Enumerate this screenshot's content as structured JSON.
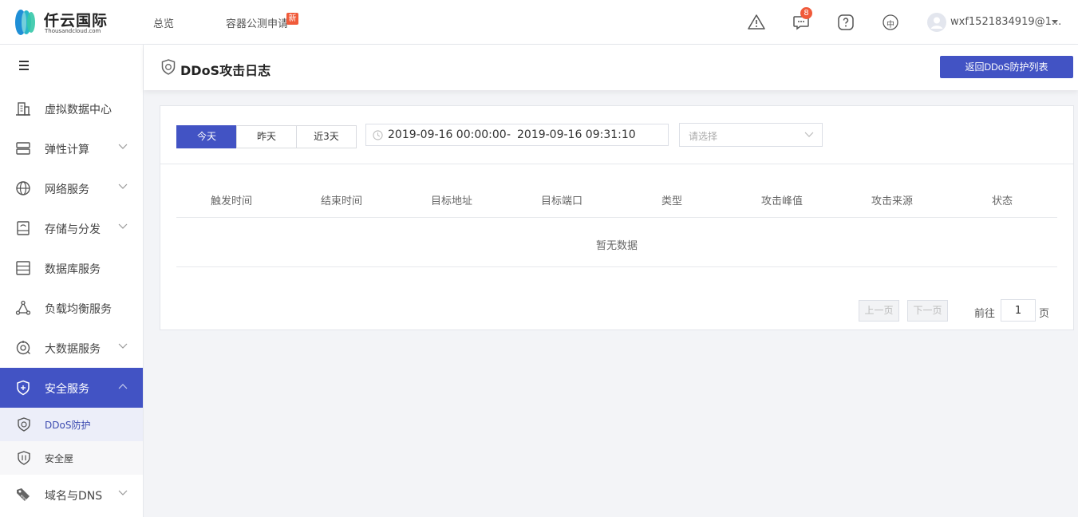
{
  "brand": {
    "name": "仟云国际",
    "subtitle": "Thousandcloud.com"
  },
  "topnav": {
    "overview": "总览",
    "container": "容器公测申请",
    "container_badge": "新"
  },
  "header_icons": {
    "alert": "alert-triangle-icon",
    "message": "chat-icon",
    "message_count": "8",
    "help": "question-icon",
    "language": "中"
  },
  "user": {
    "name": "wxf1521834919@1..."
  },
  "sidebar": {
    "items": [
      {
        "label": "虚拟数据中心",
        "icon": "building-icon"
      },
      {
        "label": "弹性计算",
        "icon": "server-icon"
      },
      {
        "label": "网络服务",
        "icon": "globe-icon"
      },
      {
        "label": "存储与分发",
        "icon": "storage-icon"
      },
      {
        "label": "数据库服务",
        "icon": "database-icon"
      },
      {
        "label": "负载均衡服务",
        "icon": "nodes-icon"
      },
      {
        "label": "大数据服务",
        "icon": "bigdata-icon"
      },
      {
        "label": "安全服务",
        "icon": "shield-icon"
      },
      {
        "label": "域名与DNS",
        "icon": "tag-icon"
      }
    ],
    "subitems": [
      {
        "label": "DDoS防护",
        "icon": "shield-icon"
      },
      {
        "label": "安全屋",
        "icon": "shield-icon"
      }
    ]
  },
  "page": {
    "title": "DDoS攻击日志",
    "back_button": "返回DDoS防护列表"
  },
  "filters": {
    "range_buttons": [
      "今天",
      "昨天",
      "近3天"
    ],
    "active_range": "今天",
    "date_start": "2019-09-16 00:00:00",
    "date_separator": "-",
    "date_end": "2019-09-16 09:31:10",
    "select_placeholder": "请选择"
  },
  "table": {
    "columns": [
      "触发时间",
      "结束时间",
      "目标地址",
      "目标端口",
      "类型",
      "攻击峰值",
      "攻击来源",
      "状态"
    ],
    "empty_text": "暂无数据"
  },
  "pagination": {
    "prev": "上一页",
    "next": "下一页",
    "goto_label": "前往",
    "page": "1",
    "page_suffix": "页"
  },
  "colors": {
    "primary": "#4253c4",
    "badge": "#f05a3a"
  }
}
